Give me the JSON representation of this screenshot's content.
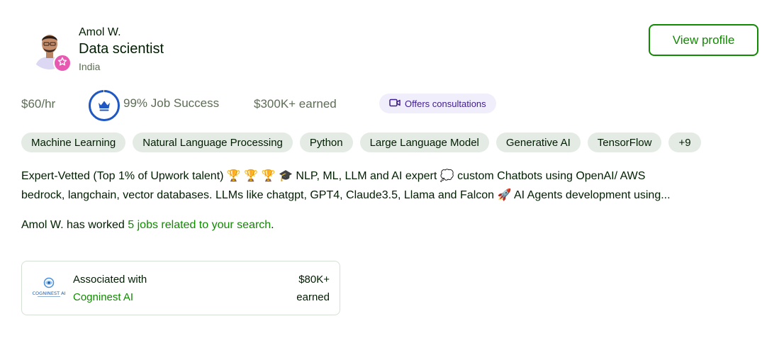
{
  "profile": {
    "name": "Amol W.",
    "title": "Data scientist",
    "country": "India",
    "view_profile_label": "View profile"
  },
  "stats": {
    "rate": "$60/hr",
    "job_success": "99% Job Success",
    "job_success_value": 99,
    "earned": "$300K+ earned",
    "consultations_label": "Offers consultations"
  },
  "skills": [
    "Machine Learning",
    "Natural Language Processing",
    "Python",
    "Large Language Model",
    "Generative AI",
    "TensorFlow",
    "+9"
  ],
  "description": {
    "line1": "Expert-Vetted (Top 1% of Upwork talent) 🏆 🏆 🏆  🎓 NLP, ML, LLM and AI expert 💭 custom Chatbots using OpenAI/ AWS",
    "line2": "bedrock, langchain, vector databases. LLMs like chatgpt, GPT4, Claude3.5, Llama and Falcon 🚀 AI Agents development using..."
  },
  "worked": {
    "prefix": "Amol W. has worked ",
    "link": "5 jobs related to your search",
    "suffix": "."
  },
  "association": {
    "label": "Associated with",
    "company": "Cogninest AI",
    "amount": "$80K+",
    "earned_label": "earned",
    "logo_text": "COGNINEST AI"
  },
  "colors": {
    "accent": "#108a00",
    "badge": "#e859b2",
    "ring": "#1f57c3",
    "consult_bg": "#f1eefc",
    "skill_bg": "#e4ebe4"
  },
  "icons": {
    "badge": "top-rated-star-icon",
    "ring": "crown-icon",
    "consult": "video-camera-icon"
  }
}
